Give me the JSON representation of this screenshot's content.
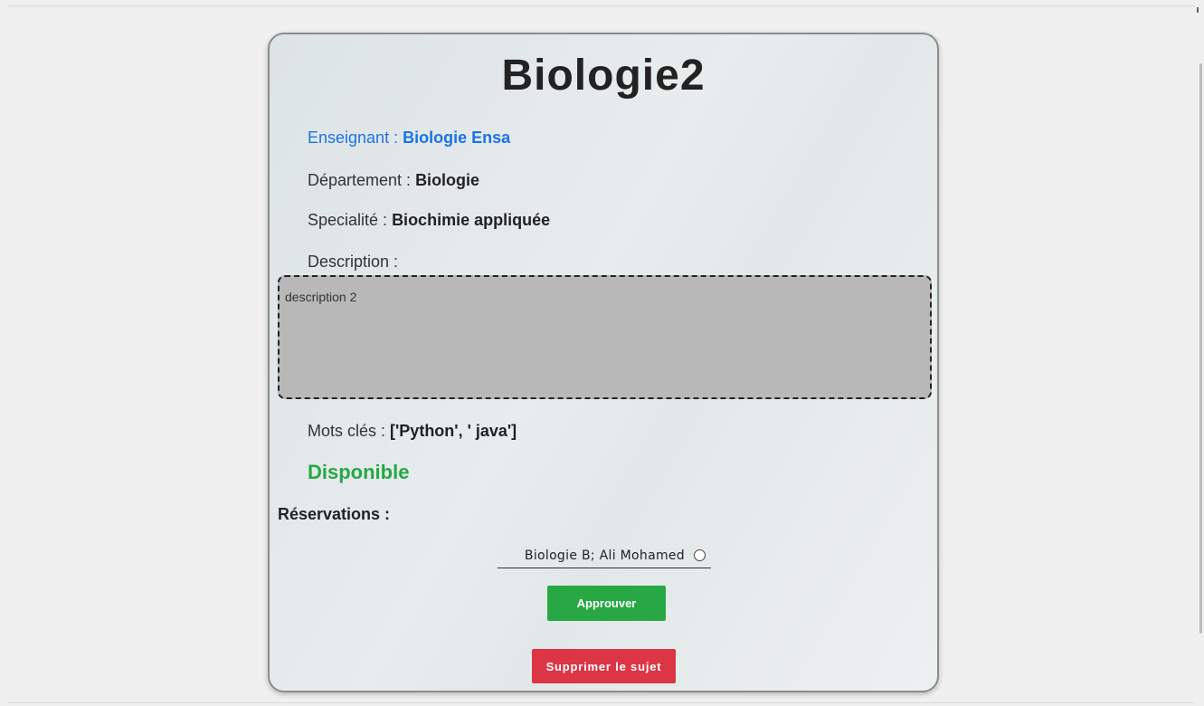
{
  "subject": {
    "title": "Biologie2",
    "teacher_label": "Enseignant : ",
    "teacher_value": "Biologie Ensa",
    "department_label": "Département : ",
    "department_value": "Biologie",
    "speciality_label": "Specialité : ",
    "speciality_value": "Biochimie appliquée",
    "description_label": "Description :",
    "description_value": "description 2",
    "keywords_label": "Mots clés : ",
    "keywords_value": "['Python', ' java']",
    "status": "Disponible"
  },
  "reservations": {
    "label": "Réservations :",
    "items": [
      {
        "text": "Biologie B; Ali Mohamed",
        "selected": false
      }
    ]
  },
  "actions": {
    "approve_label": "Approuver",
    "delete_label": "Supprimer le sujet"
  },
  "colors": {
    "link_blue": "#1a73e8",
    "available_green": "#28a745",
    "approve_green": "#28a745",
    "delete_red": "#dc3545",
    "description_bg": "#b8b8b8"
  }
}
